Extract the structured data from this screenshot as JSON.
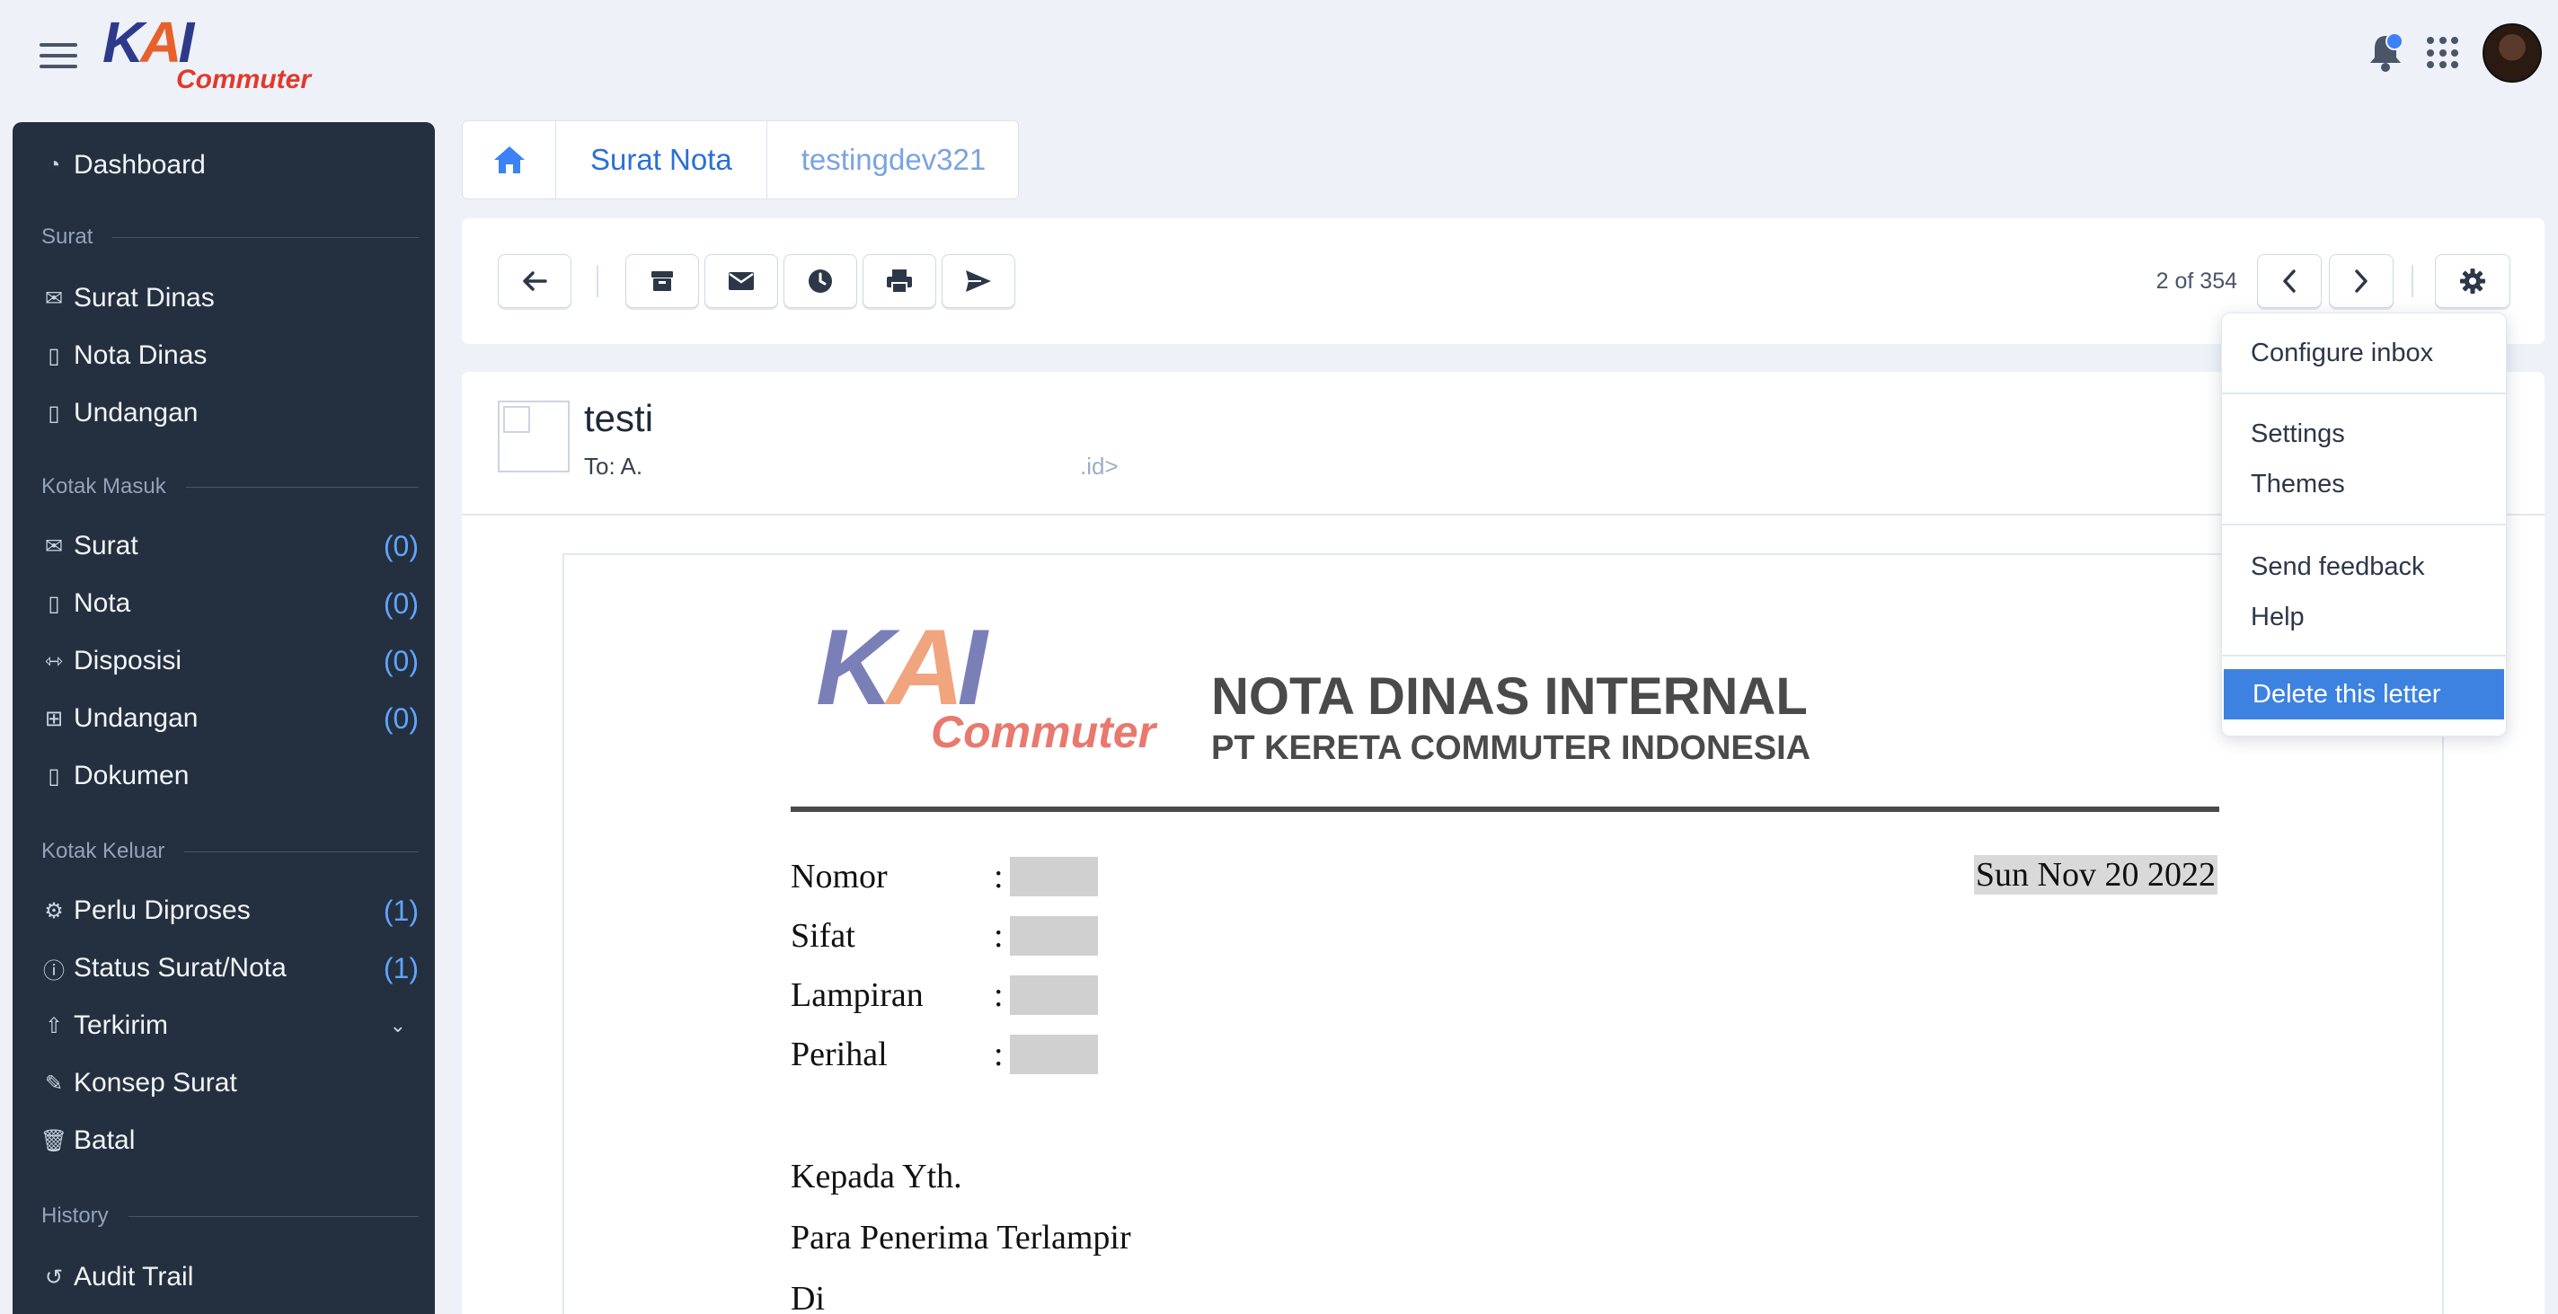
{
  "app": {
    "logo_kai_k": "K",
    "logo_kai_a": "A",
    "logo_kai_i": "I",
    "logo_commuter": "Commuter"
  },
  "sidebar": {
    "dashboard": "Dashboard",
    "sections": {
      "surat": "Surat",
      "kotak_masuk": "Kotak Masuk",
      "kotak_keluar": "Kotak Keluar",
      "history": "History"
    },
    "surat_items": [
      {
        "label": "Surat Dinas",
        "icon": "envelope-open-icon"
      },
      {
        "label": "Nota Dinas",
        "icon": "file-icon"
      },
      {
        "label": "Undangan",
        "icon": "file-icon"
      }
    ],
    "inbox_items": [
      {
        "label": "Surat",
        "count": "(0)",
        "icon": "envelope-open-icon"
      },
      {
        "label": "Nota",
        "count": "(0)",
        "icon": "file-icon"
      },
      {
        "label": "Disposisi",
        "count": "(0)",
        "icon": "people-arrows-icon"
      },
      {
        "label": "Undangan",
        "count": "(0)",
        "icon": "gift-icon"
      },
      {
        "label": "Dokumen",
        "icon": "file-icon"
      }
    ],
    "outbox_items": [
      {
        "label": "Perlu Diproses",
        "count": "(1)",
        "icon": "gear-file-icon"
      },
      {
        "label": "Status Surat/Nota",
        "count": "(1)",
        "icon": "file-info-icon"
      },
      {
        "label": "Terkirim",
        "icon": "upload-icon"
      },
      {
        "label": "Konsep Surat",
        "icon": "file-edit-icon"
      },
      {
        "label": "Batal",
        "icon": "trash-icon"
      }
    ],
    "history_items": [
      {
        "label": "Audit Trail",
        "icon": "history-icon"
      }
    ]
  },
  "breadcrumb": {
    "items": [
      "Surat Nota",
      "testingdev321"
    ]
  },
  "toolbar": {
    "pager": "2 of 354"
  },
  "mail": {
    "subject": "testi",
    "to": "To: A.",
    "to_tail": ".id>"
  },
  "document": {
    "title": "NOTA DINAS INTERNAL",
    "subtitle": "PT KERETA COMMUTER INDONESIA",
    "logo_kai_k": "K",
    "logo_kai_a": "A",
    "logo_kai_i": "I",
    "logo_commuter": "Commuter",
    "date": "Sun Nov 20 2022",
    "fields": [
      "Nomor",
      "Sifat",
      "Lampiran",
      "Perihal"
    ],
    "colon": ":",
    "salutation": [
      "Kepada Yth.",
      "Para Penerima Terlampir",
      "Di"
    ]
  },
  "dropdown": {
    "items": [
      "Configure inbox",
      "Settings",
      "Themes",
      "Send feedback",
      "Help",
      "Delete this letter"
    ]
  },
  "colors": {
    "sidebar_bg": "#243040",
    "accent": "#3d82e0",
    "count": "#60a5fa",
    "brand_blue": "#2d3a8c",
    "brand_orange": "#e8602c",
    "brand_red": "#e03a2d"
  }
}
